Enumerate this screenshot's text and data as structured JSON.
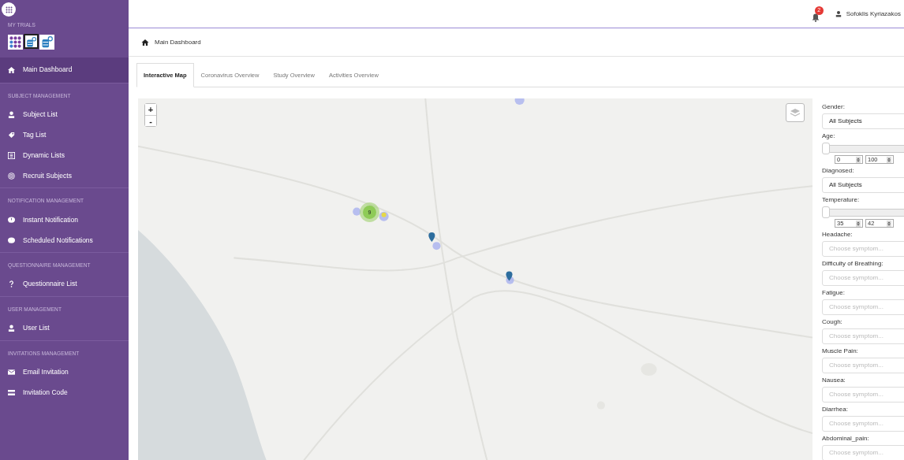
{
  "sidebar": {
    "trials_label": "MY TRIALS",
    "trials": [
      {
        "selected": false
      },
      {
        "selected": true
      },
      {
        "selected": false
      }
    ],
    "sections": [
      {
        "items": [
          {
            "label": "Main Dashboard",
            "selected": true
          }
        ]
      },
      {
        "title": "SUBJECT MANAGEMENT",
        "items": [
          {
            "label": "Subject List",
            "selected": false
          },
          {
            "label": "Tag List",
            "selected": false
          },
          {
            "label": "Dynamic Lists",
            "selected": false
          },
          {
            "label": "Recruit Subjects",
            "selected": false
          }
        ]
      },
      {
        "title": "NOTIFICATION MANAGEMENT",
        "items": [
          {
            "label": "Instant Notification",
            "selected": false
          },
          {
            "label": "Scheduled Notifications",
            "selected": false
          }
        ]
      },
      {
        "title": "QUESTIONNAIRE MANAGEMENT",
        "items": [
          {
            "label": "Questionnaire List",
            "selected": false
          }
        ]
      },
      {
        "title": "USER MANAGEMENT",
        "items": [
          {
            "label": "User List",
            "selected": false
          }
        ]
      },
      {
        "title": "INVITATIONS MANAGEMENT",
        "items": [
          {
            "label": "Email Invitation",
            "selected": false
          },
          {
            "label": "Invitation Code",
            "selected": false
          }
        ]
      }
    ]
  },
  "topbar": {
    "notifications": "2",
    "user": "Sofoklis Kyriazakos"
  },
  "breadcrumb": "Main Dashboard",
  "tabs": [
    {
      "label": "Interactive Map",
      "selected": true
    },
    {
      "label": "Coronavirus Overview",
      "selected": false
    },
    {
      "label": "Study Overview",
      "selected": false
    },
    {
      "label": "Activities Overview",
      "selected": false
    }
  ],
  "map": {
    "zoom_in": "+",
    "zoom_out": "-",
    "cluster_count": "9"
  },
  "filters": [
    {
      "kind": "select",
      "label": "Gender:",
      "value": "All Subjects"
    },
    {
      "kind": "range",
      "label": "Age:",
      "level": 1,
      "min": "0",
      "max": "100"
    },
    {
      "kind": "select",
      "label": "Diagnosed:",
      "value": "All Subjects"
    },
    {
      "kind": "range",
      "label": "Temperature:",
      "level": 1,
      "min": "35",
      "max": "42"
    },
    {
      "kind": "select",
      "label": "Headache:",
      "placeholder": "Choose symptom..."
    },
    {
      "kind": "select",
      "label": "Difficulty of Breathing:",
      "placeholder": "Choose symptom..."
    },
    {
      "kind": "select",
      "label": "Fatigue:",
      "placeholder": "Choose symptom..."
    },
    {
      "kind": "select",
      "label": "Cough:",
      "placeholder": "Choose symptom..."
    },
    {
      "kind": "select",
      "label": "Muscle Pain:",
      "placeholder": "Choose symptom..."
    },
    {
      "kind": "select",
      "label": "Nausea:",
      "placeholder": "Choose symptom..."
    },
    {
      "kind": "select",
      "label": "Diarrhea:",
      "placeholder": "Choose symptom..."
    },
    {
      "kind": "select",
      "label": "Abdominal_pain:",
      "placeholder": "Choose symptom..."
    }
  ]
}
